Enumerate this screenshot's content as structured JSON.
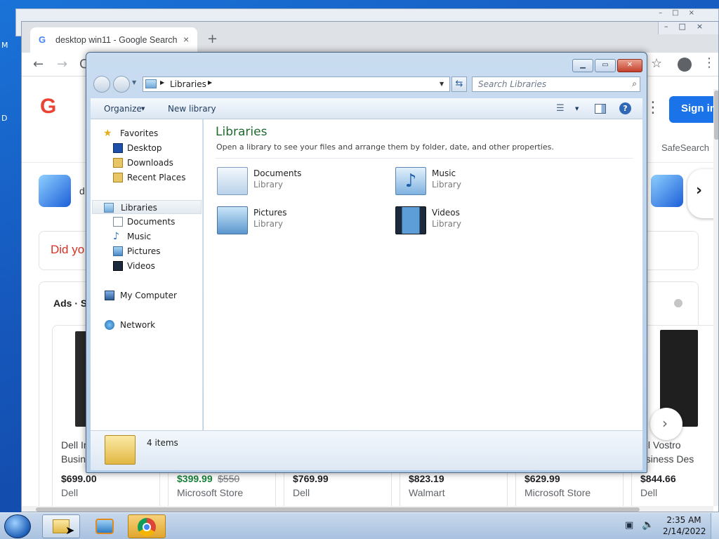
{
  "desktop": {
    "edge_labels": [
      "M",
      "D"
    ]
  },
  "chrome": {
    "tab_title": "desktop win11 - Google Search",
    "new_tab_symbol": "+",
    "sign_in": "Sign in",
    "safesearch": "SafeSearch",
    "search_query_partial": "d",
    "did_you_mean": "Did yo",
    "ads_label": "Ads · S",
    "products": [
      {
        "name": "Dell In\nBusin",
        "price": "$699.00",
        "old_price": "",
        "store": "Dell"
      },
      {
        "name": "",
        "price": "$399.99",
        "old_price": "$550",
        "store": "Microsoft Store"
      },
      {
        "name": "",
        "price": "$769.99",
        "old_price": "",
        "store": "Dell"
      },
      {
        "name": "",
        "price": "$823.19",
        "old_price": "",
        "store": "Walmart"
      },
      {
        "name": "",
        "price": "$629.99",
        "old_price": "",
        "store": "Microsoft Store"
      },
      {
        "name": "ell Vostro\nusiness Des",
        "price": "$844.66",
        "old_price": "",
        "store": "Dell"
      }
    ]
  },
  "explorer": {
    "address_root": "Libraries",
    "search_placeholder": "Search Libraries",
    "toolbar": {
      "organize": "Organize",
      "new_library": "New library"
    },
    "heading": "Libraries",
    "description": "Open a library to see your files and arrange them by folder, date, and other properties.",
    "nav": {
      "favorites": "Favorites",
      "favorites_items": [
        "Desktop",
        "Downloads",
        "Recent Places"
      ],
      "libraries": "Libraries",
      "library_items": [
        "Documents",
        "Music",
        "Pictures",
        "Videos"
      ],
      "computer": "My Computer",
      "network": "Network"
    },
    "libraries": [
      {
        "name": "Documents",
        "type": "Library"
      },
      {
        "name": "Music",
        "type": "Library"
      },
      {
        "name": "Pictures",
        "type": "Library"
      },
      {
        "name": "Videos",
        "type": "Library"
      }
    ],
    "status": "4 items"
  },
  "taskbar": {
    "time": "2:35 AM",
    "date": "2/14/2022"
  },
  "colors": {
    "library_heading": "#1e6a2e",
    "google_blue": "#1a73e8",
    "price_green": "#188038"
  }
}
